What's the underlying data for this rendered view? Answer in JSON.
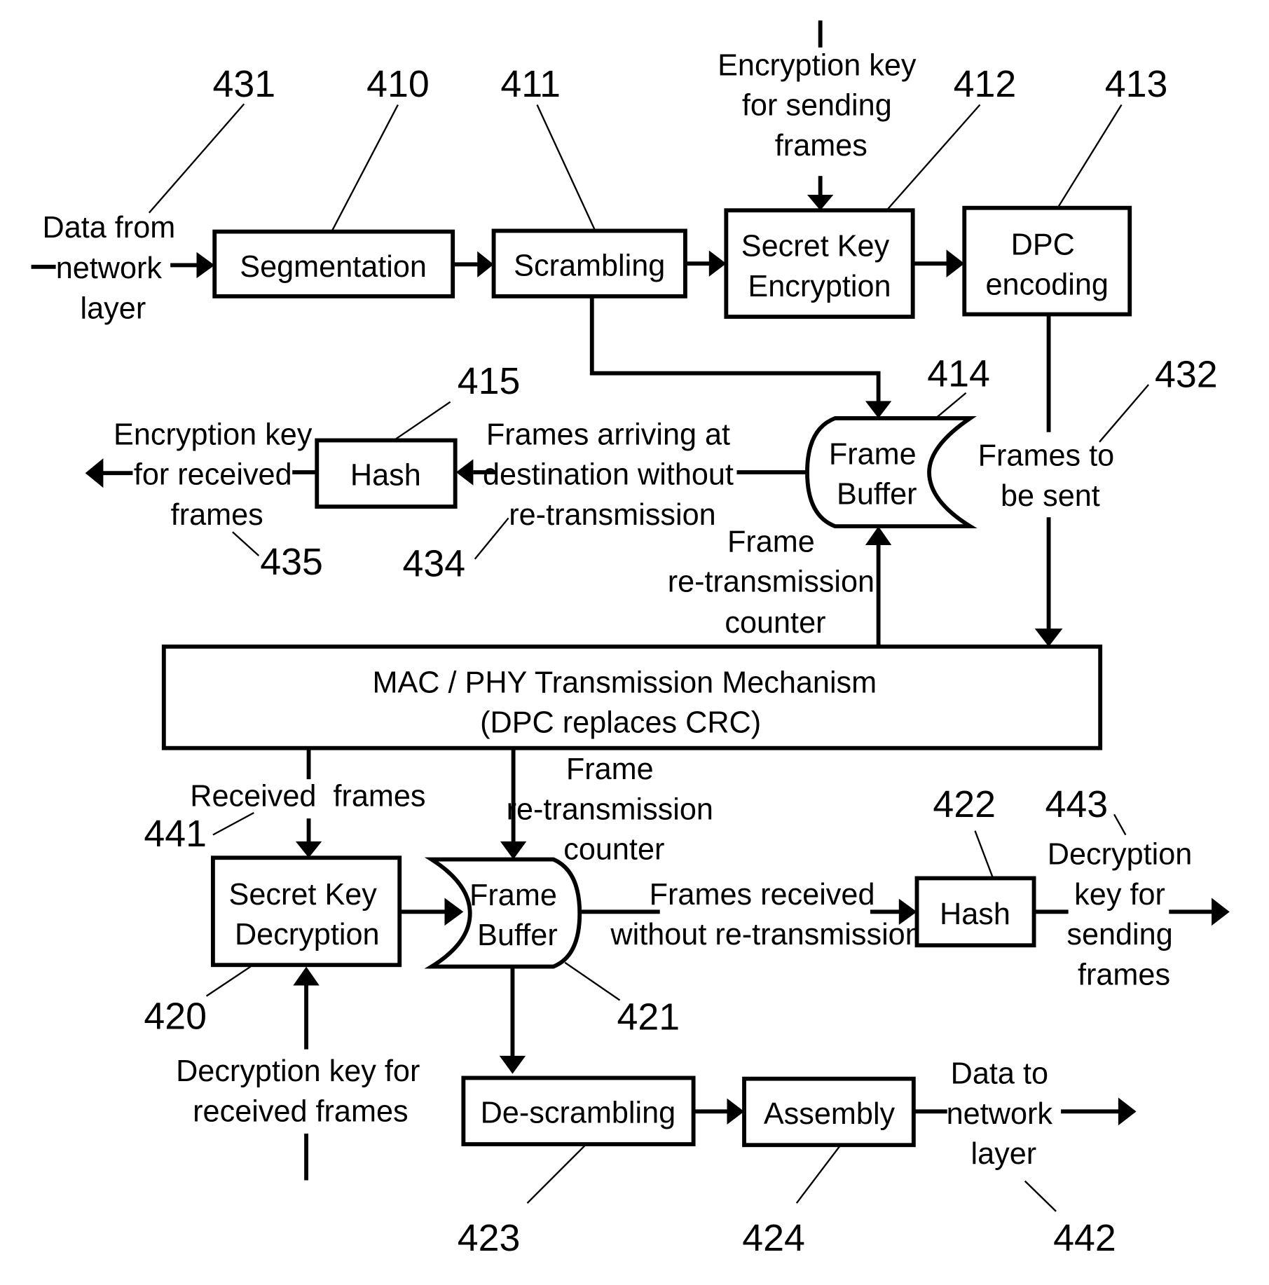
{
  "diagram": {
    "blocks": {
      "segmentation": {
        "ref": "410",
        "lines": [
          "Segmentation"
        ]
      },
      "scrambling": {
        "ref": "411",
        "lines": [
          "Scrambling"
        ]
      },
      "sk_encryption": {
        "ref": "412",
        "lines": [
          "Secret Key",
          "Encryption"
        ]
      },
      "dpc_encoding": {
        "ref": "413",
        "lines": [
          "DPC",
          "encoding"
        ]
      },
      "tx_frame_buffer": {
        "ref": "414",
        "lines": [
          "Frame",
          "Buffer"
        ]
      },
      "tx_hash": {
        "ref": "415",
        "lines": [
          "Hash"
        ]
      },
      "mac_phy": {
        "lines": [
          "MAC / PHY Transmission Mechanism",
          "(DPC replaces CRC)"
        ]
      },
      "sk_decryption": {
        "ref": "420",
        "lines": [
          "Secret Key",
          "Decryption"
        ]
      },
      "rx_frame_buffer": {
        "ref": "421",
        "lines": [
          "Frame",
          "Buffer"
        ]
      },
      "rx_hash": {
        "ref": "422",
        "lines": [
          "Hash"
        ]
      },
      "descrambling": {
        "ref": "423",
        "lines": [
          "De-scrambling"
        ]
      },
      "assembly": {
        "ref": "424",
        "lines": [
          "Assembly"
        ]
      }
    },
    "signals": {
      "data_from_network": {
        "ref": "431",
        "lines": [
          "Data from",
          "network",
          "layer"
        ]
      },
      "enc_key_sending": {
        "lines": [
          "Encryption key",
          "for sending",
          "frames"
        ]
      },
      "frames_to_be_sent": {
        "ref": "432",
        "lines": [
          "Frames to",
          "be sent"
        ]
      },
      "frames_arriving": {
        "ref": "434",
        "lines": [
          "Frames arriving at",
          "destination without",
          "re-transmission"
        ]
      },
      "enc_key_received": {
        "ref": "435",
        "lines": [
          "Encryption key",
          "for received",
          "frames"
        ]
      },
      "tx_retx_counter": {
        "lines": [
          "Frame",
          "re-transmission",
          "counter"
        ]
      },
      "received_frames": {
        "ref": "441",
        "lines": [
          "Received  frames"
        ]
      },
      "rx_retx_counter": {
        "lines": [
          "Frame",
          "re-transmission",
          "counter"
        ]
      },
      "frames_received_no_retx": {
        "lines": [
          "Frames received",
          "without re-transmission"
        ]
      },
      "dec_key_sending": {
        "ref": "443",
        "lines": [
          "Decryption",
          "key for",
          "sending",
          "frames"
        ]
      },
      "dec_key_received": {
        "lines": [
          "Decryption key for",
          "received frames"
        ]
      },
      "data_to_network": {
        "ref": "442",
        "lines": [
          "Data to",
          "network",
          "layer"
        ]
      }
    }
  }
}
